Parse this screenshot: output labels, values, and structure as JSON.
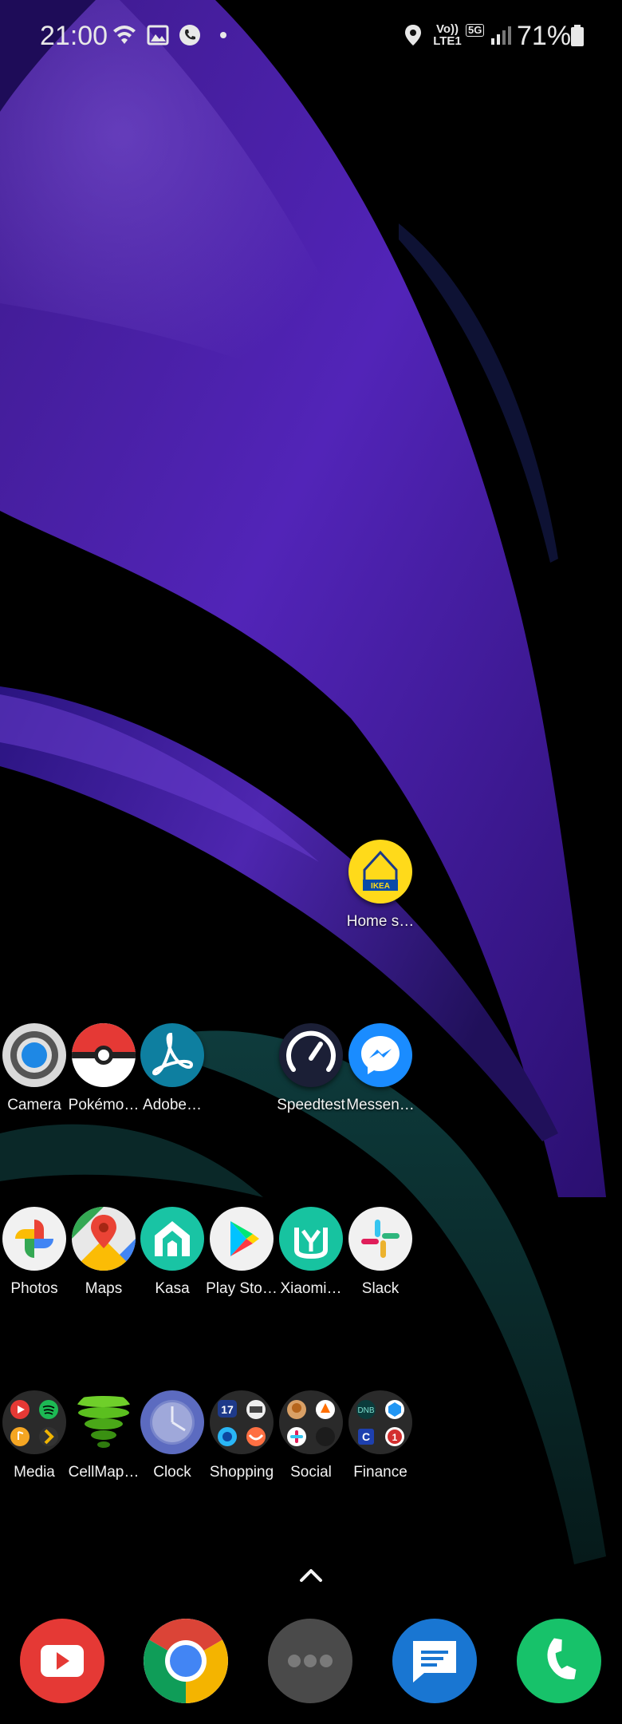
{
  "status_bar": {
    "time": "21:00",
    "volte": "Vo))\nLTE1",
    "network": "5G",
    "battery": "71%",
    "left_icons": [
      "wifi-icon",
      "image-icon",
      "call-icon",
      "dot-icon"
    ],
    "right_icons": [
      "location-icon",
      "signal-icon",
      "battery-icon"
    ]
  },
  "home": {
    "widget_app": {
      "label": "Home s…",
      "icon": "ikea-home-icon"
    },
    "row1": [
      {
        "label": "Camera",
        "icon": "camera-icon"
      },
      {
        "label": "Pokémo…",
        "icon": "pokeball-icon"
      },
      {
        "label": "Adobe…",
        "icon": "adobe-acrobat-icon"
      },
      {
        "label": "Speedtest",
        "icon": "speedtest-icon"
      },
      {
        "label": "Messen…",
        "icon": "messenger-icon"
      }
    ],
    "row2": [
      {
        "label": "Photos",
        "icon": "photos-icon"
      },
      {
        "label": "Maps",
        "icon": "maps-icon"
      },
      {
        "label": "Kasa",
        "icon": "kasa-icon"
      },
      {
        "label": "Play Sto…",
        "icon": "play-store-icon"
      },
      {
        "label": "Xiaomi…",
        "icon": "xiaomi-home-icon"
      },
      {
        "label": "Slack",
        "icon": "slack-icon"
      }
    ],
    "row3": [
      {
        "label": "Media",
        "icon": "media-folder-icon"
      },
      {
        "label": "CellMap…",
        "icon": "cellmapper-icon"
      },
      {
        "label": "Clock",
        "icon": "clock-icon"
      },
      {
        "label": "Shopping",
        "icon": "shopping-folder-icon"
      },
      {
        "label": "Social",
        "icon": "social-folder-icon"
      },
      {
        "label": "Finance",
        "icon": "finance-folder-icon"
      }
    ]
  },
  "dock": [
    "youtube-icon",
    "chrome-icon",
    "more-apps-icon",
    "messages-icon",
    "phone-icon"
  ],
  "colors": {
    "wallpaper_purple": "#4a1ca8",
    "wallpaper_teal": "#0d3a3a",
    "label_text": "#f2f2f2"
  }
}
